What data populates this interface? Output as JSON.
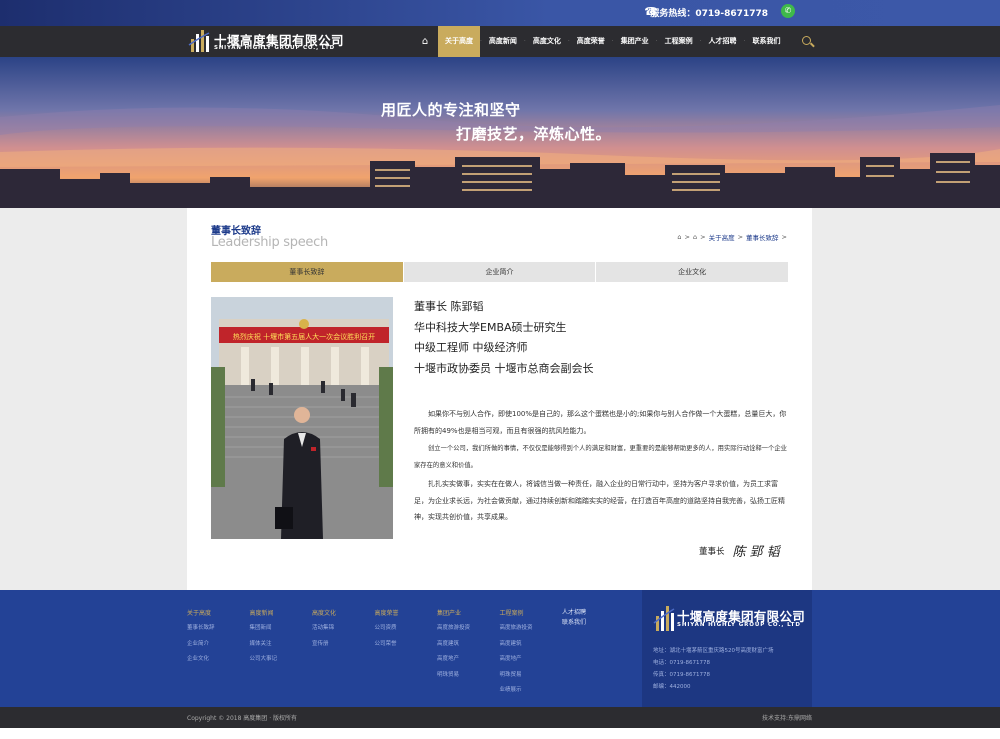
{
  "topbar": {
    "hotline": "服务热线：0719-8671778",
    "phone_icon": "☎",
    "wechat_icon": "wechat-icon"
  },
  "logo": {
    "cn": "十堰高度集团有限公司",
    "en": "SHIYAN HIGHLY GROUP CO., LTD"
  },
  "nav": {
    "items": [
      "关于高度",
      "高度新闻",
      "高度文化",
      "高度荣誉",
      "集团产业",
      "工程案例",
      "人才招聘",
      "联系我们"
    ],
    "active_index": 0
  },
  "banner": {
    "line1": "用匠人的专注和坚守",
    "line2": "打磨技艺，淬炼心性。"
  },
  "section": {
    "title_cn": "董事长致辞",
    "title_en": "Leadership speech"
  },
  "breadcrumb": {
    "items": [
      "关于高度",
      "董事长致辞"
    ],
    "sep": ">"
  },
  "tabs": [
    "董事长致辞",
    "企业简介",
    "企业文化"
  ],
  "profile": {
    "lines": [
      "董事长 陈郢韬",
      "华中科技大学EMBA硕士研究生",
      "中级工程师 中级经济师",
      "十堰市政协委员 十堰市总商会副会长"
    ],
    "photo_banner_text": "热烈庆祝 十堰市第五届人大一次会议胜利召开",
    "photo_alt": "chairman-photo"
  },
  "body": [
    "如果你不与别人合作，即使100%是自己的，那么这个蛋糕也是小的;如果你与别人合作做一个大蛋糕，总量巨大，你所拥有的49%也是相当可观，而且有很强的抗风险能力。",
    "创立一个公司，我们所做的事情，不仅仅是能够得到个人的满足和财富，更重要的是能够帮助更多的人，用实际行动诠释一个企业家存在的意义和价值。",
    "扎扎实实做事，实实在在做人，将诚信当做一种责任，融入企业的日常行动中，坚持为客户寻求价值，为员工求富足，为企业求长远，为社会做贡献，通过持续创新和踏踏实实的经营，在打造百年高度的道路坚持自我完善，弘扬工匠精神，实现共创价值，共享成果。"
  ],
  "signature": {
    "label": "董事长",
    "name": "陈郢韬"
  },
  "footer": {
    "columns": [
      {
        "head": "关于高度",
        "items": [
          "董事长致辞",
          "企业简介",
          "企业文化"
        ]
      },
      {
        "head": "高度新闻",
        "items": [
          "集团新闻",
          "媒体关注",
          "公司大事记"
        ]
      },
      {
        "head": "高度文化",
        "items": [
          "活动集锦",
          "宣传册"
        ]
      },
      {
        "head": "高度荣誉",
        "items": [
          "公司资质",
          "公司荣誉"
        ]
      },
      {
        "head": "集团产业",
        "items": [
          "高度旅游投资",
          "高度建筑",
          "高度地产",
          "明珠贸易"
        ]
      },
      {
        "head": "工程案例",
        "items": [
          "高度旅游投资",
          "高度建筑",
          "高度地产",
          "明珠贸易",
          "业绩展示"
        ]
      },
      {
        "head": "人才招聘",
        "items": []
      },
      {
        "head": "联系我们",
        "items": []
      }
    ],
    "contact": [
      "地址：湖北十堰茅箭区重庆路520号高度财富广场",
      "电话：0719-8671778",
      "传真：0719-8671778",
      "邮编：442000"
    ]
  },
  "bottom": {
    "copyright": "Copyright © 2018 高度集团 · 版权所有",
    "tech": "技术支持:东鼎网络"
  }
}
